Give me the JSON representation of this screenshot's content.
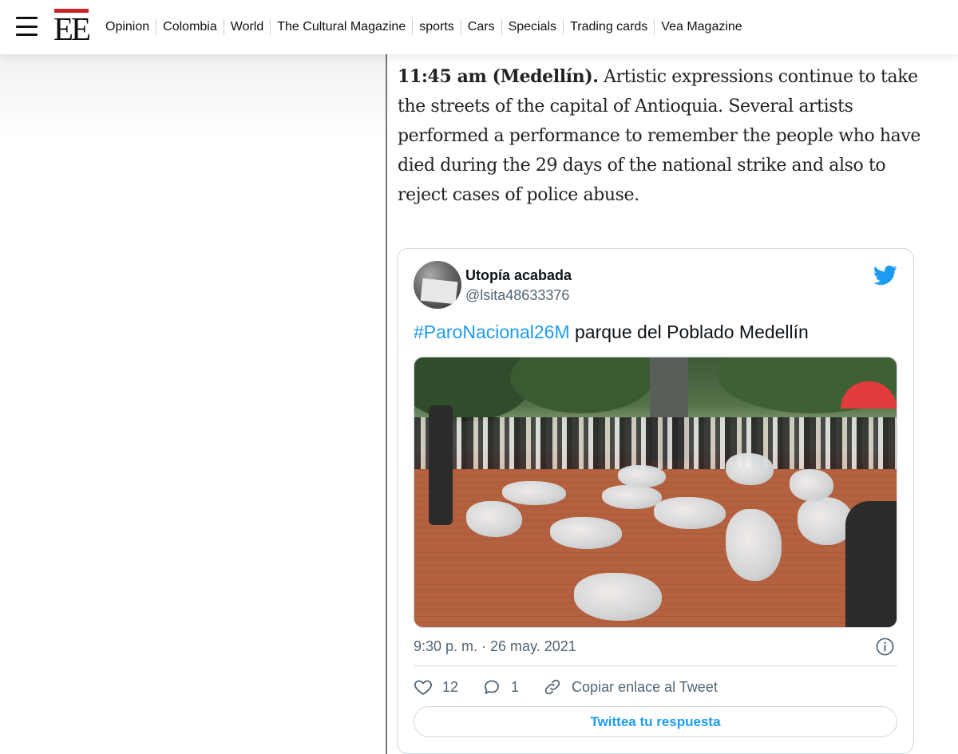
{
  "header": {
    "logo_text": "EE",
    "nav": [
      "Opinion",
      "Colombia",
      "World",
      "The Cultural Magazine",
      "sports",
      "Cars",
      "Specials",
      "Trading cards",
      "Vea Magazine"
    ]
  },
  "article": {
    "lead_bold": "11:45 am (Medellín).",
    "body": " Artistic expressions continue to take the streets of the capital of Antioquia. Several artists performed a performance to remember the people who have died during the 29 days of the national strike and also to reject cases of police abuse."
  },
  "tweet": {
    "name": "Utopía acabada",
    "handle": "@lsita48633376",
    "hashtag": "#ParoNacional26M",
    "text": " parque del Poblado Medellín",
    "timestamp": "9:30 p. m. · 26 may. 2021",
    "likes": "12",
    "replies": "1",
    "copy_link": "Copiar enlace al Tweet",
    "reply_button": "Twittea tu respuesta"
  },
  "colors": {
    "brand_red": "#d0202a",
    "twitter_blue": "#1d9bf0"
  },
  "icons": [
    "menu-icon",
    "twitter-bird-icon",
    "info-icon",
    "heart-icon",
    "reply-icon",
    "link-icon"
  ]
}
